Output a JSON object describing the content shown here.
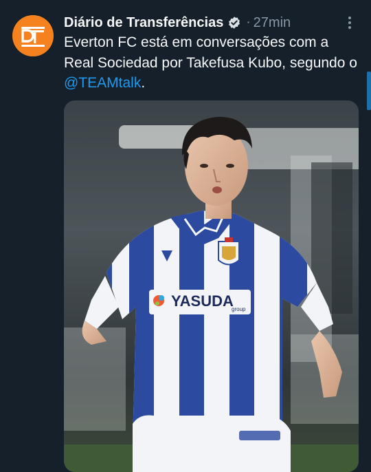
{
  "tweet": {
    "author_name": "Diário de Transferências",
    "separator": "·",
    "time": "27min",
    "text_before": "Everton FC está em conversações com a Real Sociedad por Takefusa Kubo, segundo o ",
    "mention": "@TEAMtalk",
    "text_after": ".",
    "avatar_text": "DT",
    "media": {
      "sponsor_text": "YASUDA",
      "sponsor_subtext": "group"
    }
  },
  "icons": {
    "avatar": "avatar-logo",
    "verified": "verified-badge-icon",
    "more": "more-options-icon"
  },
  "colors": {
    "background": "#15202b",
    "accent": "#1d9bf0",
    "avatar": "#f5821f",
    "secondary_text": "#8b98a5"
  }
}
